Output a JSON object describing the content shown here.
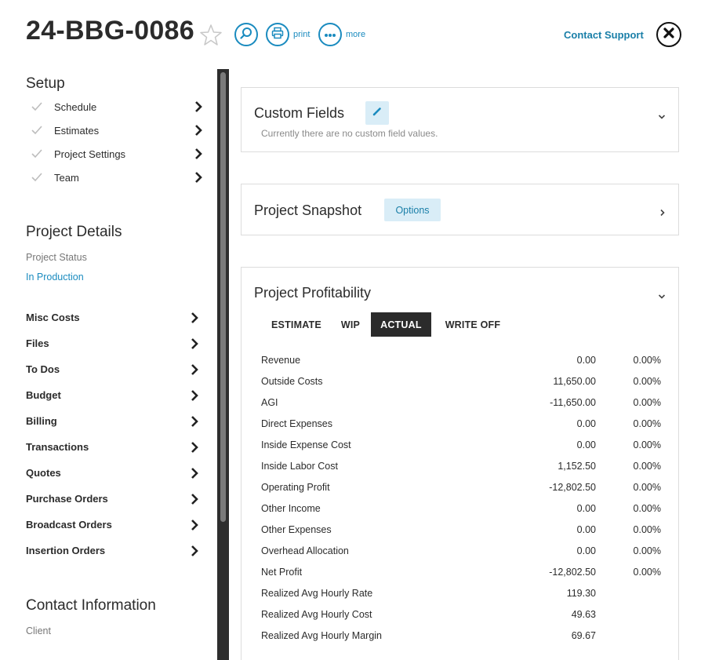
{
  "header": {
    "project_id": "24-BBG-0086",
    "print_label": "print",
    "more_label": "more",
    "contact_support": "Contact Support",
    "accent_color": "#1a8bbf"
  },
  "setup": {
    "title": "Setup",
    "items": [
      {
        "label": "Schedule"
      },
      {
        "label": "Estimates"
      },
      {
        "label": "Project Settings"
      },
      {
        "label": "Team"
      }
    ]
  },
  "project_details": {
    "title": "Project Details",
    "status_label": "Project Status",
    "status_value": "In Production",
    "nav": [
      {
        "label": "Misc Costs"
      },
      {
        "label": "Files"
      },
      {
        "label": "To Dos"
      },
      {
        "label": "Budget"
      },
      {
        "label": "Billing"
      },
      {
        "label": "Transactions"
      },
      {
        "label": "Quotes"
      },
      {
        "label": "Purchase Orders"
      },
      {
        "label": "Broadcast Orders"
      },
      {
        "label": "Insertion Orders"
      }
    ]
  },
  "contact": {
    "title": "Contact Information",
    "client_label": "Client"
  },
  "custom_fields": {
    "title": "Custom Fields",
    "empty_message": "Currently there are no custom field values."
  },
  "snapshot": {
    "title": "Project Snapshot",
    "options_label": "Options"
  },
  "profitability": {
    "title": "Project Profitability",
    "tabs": [
      {
        "label": "ESTIMATE",
        "active": false
      },
      {
        "label": "WIP",
        "active": false
      },
      {
        "label": "ACTUAL",
        "active": true
      },
      {
        "label": "WRITE OFF",
        "active": false
      }
    ],
    "rows": [
      {
        "label": "Revenue",
        "value": "0.00",
        "pct": "0.00%"
      },
      {
        "label": "Outside Costs",
        "value": "11,650.00",
        "pct": "0.00%"
      },
      {
        "label": "AGI",
        "value": "-11,650.00",
        "pct": "0.00%"
      },
      {
        "label": "Direct Expenses",
        "value": "0.00",
        "pct": "0.00%"
      },
      {
        "label": "Inside Expense Cost",
        "value": "0.00",
        "pct": "0.00%"
      },
      {
        "label": "Inside Labor Cost",
        "value": "1,152.50",
        "pct": "0.00%"
      },
      {
        "label": "Operating Profit",
        "value": "-12,802.50",
        "pct": "0.00%"
      },
      {
        "label": "Other Income",
        "value": "0.00",
        "pct": "0.00%"
      },
      {
        "label": "Other Expenses",
        "value": "0.00",
        "pct": "0.00%"
      },
      {
        "label": "Overhead Allocation",
        "value": "0.00",
        "pct": "0.00%"
      },
      {
        "label": "Net Profit",
        "value": "-12,802.50",
        "pct": "0.00%"
      },
      {
        "label": "Realized Avg Hourly Rate",
        "value": "119.30",
        "pct": ""
      },
      {
        "label": "Realized Avg Hourly Cost",
        "value": "49.63",
        "pct": ""
      },
      {
        "label": "Realized Avg Hourly Margin",
        "value": "69.67",
        "pct": ""
      }
    ]
  }
}
